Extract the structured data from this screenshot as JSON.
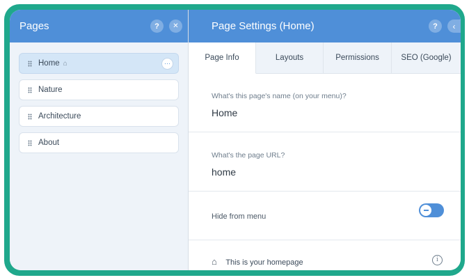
{
  "pages_panel": {
    "title": "Pages",
    "help_icon": "?",
    "close_icon": "✕",
    "items": [
      {
        "label": "Home",
        "is_home": true,
        "active": true
      },
      {
        "label": "Nature"
      },
      {
        "label": "Architecture"
      },
      {
        "label": "About"
      }
    ],
    "more_icon": "···"
  },
  "settings_panel": {
    "title": "Page Settings (Home)",
    "help_icon": "?",
    "back_icon": "‹",
    "tabs": [
      {
        "label": "Page Info",
        "active": true
      },
      {
        "label": "Layouts"
      },
      {
        "label": "Permissions"
      },
      {
        "label": "SEO (Google)"
      }
    ],
    "page_name": {
      "label": "What's this page's name (on your menu)?",
      "value": "Home"
    },
    "page_url": {
      "label": "What's the page URL?",
      "value": "home"
    },
    "hide_from_menu": {
      "label": "Hide from menu",
      "enabled": false
    },
    "homepage_note": {
      "label": "This is your homepage",
      "info_icon": "i"
    }
  },
  "colors": {
    "frame": "#1fa88c",
    "header": "#4f8fd8",
    "panel_bg": "#eef3f9",
    "active_item": "#d4e6f7"
  }
}
